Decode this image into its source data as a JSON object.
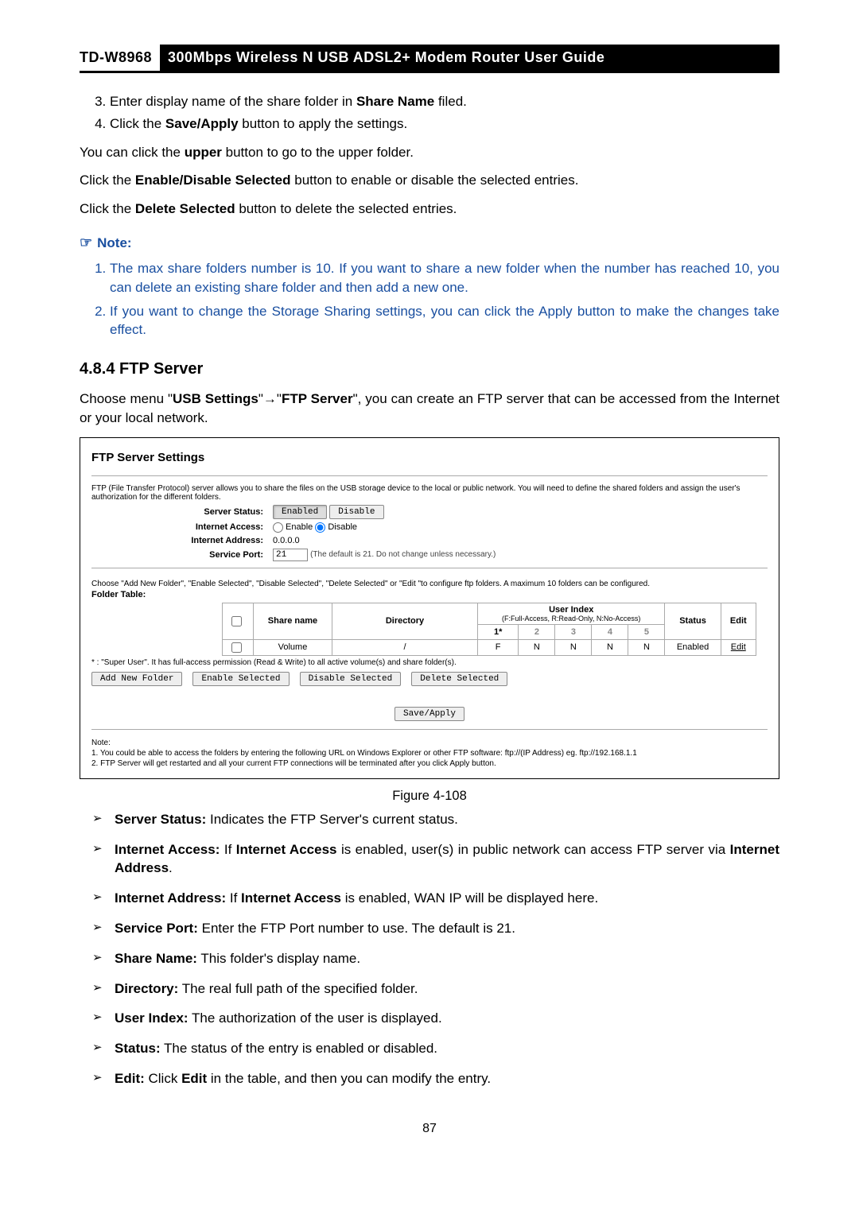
{
  "header": {
    "model": "TD-W8968",
    "title": "300Mbps Wireless N USB ADSL2+ Modem Router User Guide"
  },
  "steps": {
    "s3_pre": "Enter display name of the share folder in ",
    "s3_b": "Share Name",
    "s3_post": " filed.",
    "s4_pre": "Click the ",
    "s4_b": "Save/Apply",
    "s4_post": " button to apply the settings."
  },
  "para_upper_pre": "You can click the ",
  "para_upper_b": "upper",
  "para_upper_post": " button to go to the upper folder.",
  "para_enable_pre": "Click the ",
  "para_enable_b": "Enable/Disable Selected",
  "para_enable_post": " button to enable or disable the selected entries.",
  "para_delete_pre": "Click the ",
  "para_delete_b": "Delete Selected",
  "para_delete_post": " button to delete the selected entries.",
  "note_label": "Note:",
  "notes": {
    "n1": "The max share folders number is 10. If you want to share a new folder when the number has reached 10, you can delete an existing share folder and then add a new one.",
    "n2": "If you want to change the Storage Sharing settings, you can click the Apply button to make the changes take effect."
  },
  "section_heading": "4.8.4  FTP Server",
  "ftp_intro_pre": "Choose menu \"",
  "ftp_intro_b1": "USB Settings",
  "ftp_intro_arrow": "\"→\"",
  "ftp_intro_b2": "FTP Server",
  "ftp_intro_post": "\", you can create an FTP server that can be accessed from the Internet or your local network.",
  "screenshot": {
    "title": "FTP Server Settings",
    "desc": "FTP (File Transfer Protocol) server allows you to share the files on the USB storage device to the local or public network. You will need to define the shared folders and assign the user's authorization for the different folders.",
    "labels": {
      "server_status": "Server Status:",
      "internet_access": "Internet Access:",
      "internet_address": "Internet Address:",
      "service_port": "Service Port:"
    },
    "values": {
      "enabled_btn": "Enabled",
      "disable_btn": "Disable",
      "enable_radio": "Enable",
      "disable_radio": "Disable",
      "internet_address": "0.0.0.0",
      "service_port_value": "21",
      "service_port_hint": "(The default is 21. Do not change unless necessary.)"
    },
    "mid_desc": "Choose \"Add New Folder\", \"Enable Selected\", \"Disable Selected\", \"Delete Selected\" or \"Edit \"to configure ftp folders. A maximum 10 folders can be configured.",
    "folder_table_label": "Folder Table:",
    "table": {
      "headers": {
        "share_name": "Share name",
        "directory": "Directory",
        "user_index": "User Index",
        "user_index_sub": "(F:Full-Access, R:Read-Only, N:No-Access)",
        "status": "Status",
        "edit": "Edit",
        "u1": "1*",
        "u2": "2",
        "u3": "3",
        "u4": "4",
        "u5": "5"
      },
      "row": {
        "share_name": "Volume",
        "directory": "/",
        "u1": "F",
        "u2": "N",
        "u3": "N",
        "u4": "N",
        "u5": "N",
        "status": "Enabled",
        "edit": "Edit"
      }
    },
    "super_user_note": "* : \"Super User\". It has full-access permission (Read & Write) to all active volume(s) and share folder(s).",
    "buttons": {
      "add": "Add New Folder",
      "enable": "Enable Selected",
      "disable": "Disable Selected",
      "delete": "Delete Selected",
      "save": "Save/Apply"
    },
    "foot_note_label": "Note:",
    "foot_note_1": "1. You could be able to access the folders by entering the following URL on Windows Explorer or other FTP software: ftp://(IP Address) eg. ftp://192.168.1.1",
    "foot_note_2": "2. FTP Server will get restarted and all your current FTP connections will be terminated after you click Apply button."
  },
  "figure_caption": "Figure 4-108",
  "defs": {
    "d1_b": "Server Status:",
    "d1_t": " Indicates the FTP Server's current status.",
    "d2_b1": "Internet Access:",
    "d2_t1": " If ",
    "d2_b2": "Internet Access",
    "d2_t2": " is enabled, user(s) in public network can access FTP server via ",
    "d2_b3": "Internet Address",
    "d2_t3": ".",
    "d3_b1": "Internet Address:",
    "d3_t1": " If ",
    "d3_b2": "Internet Access",
    "d3_t2": " is enabled, WAN IP will be displayed here.",
    "d4_b": "Service Port:",
    "d4_t": " Enter the FTP Port number to use. The default is 21.",
    "d5_b": "Share Name:",
    "d5_t": " This folder's display name.",
    "d6_b": "Directory:",
    "d6_t": " The real full path of the specified folder.",
    "d7_b": "User Index:",
    "d7_t": " The authorization of the user is displayed.",
    "d8_b": "Status:",
    "d8_t": " The status of the entry is enabled or disabled.",
    "d9_b": "Edit:",
    "d9_t1": " Click ",
    "d9_b2": "Edit",
    "d9_t2": " in the table, and then you can modify the entry."
  },
  "page_number": "87"
}
